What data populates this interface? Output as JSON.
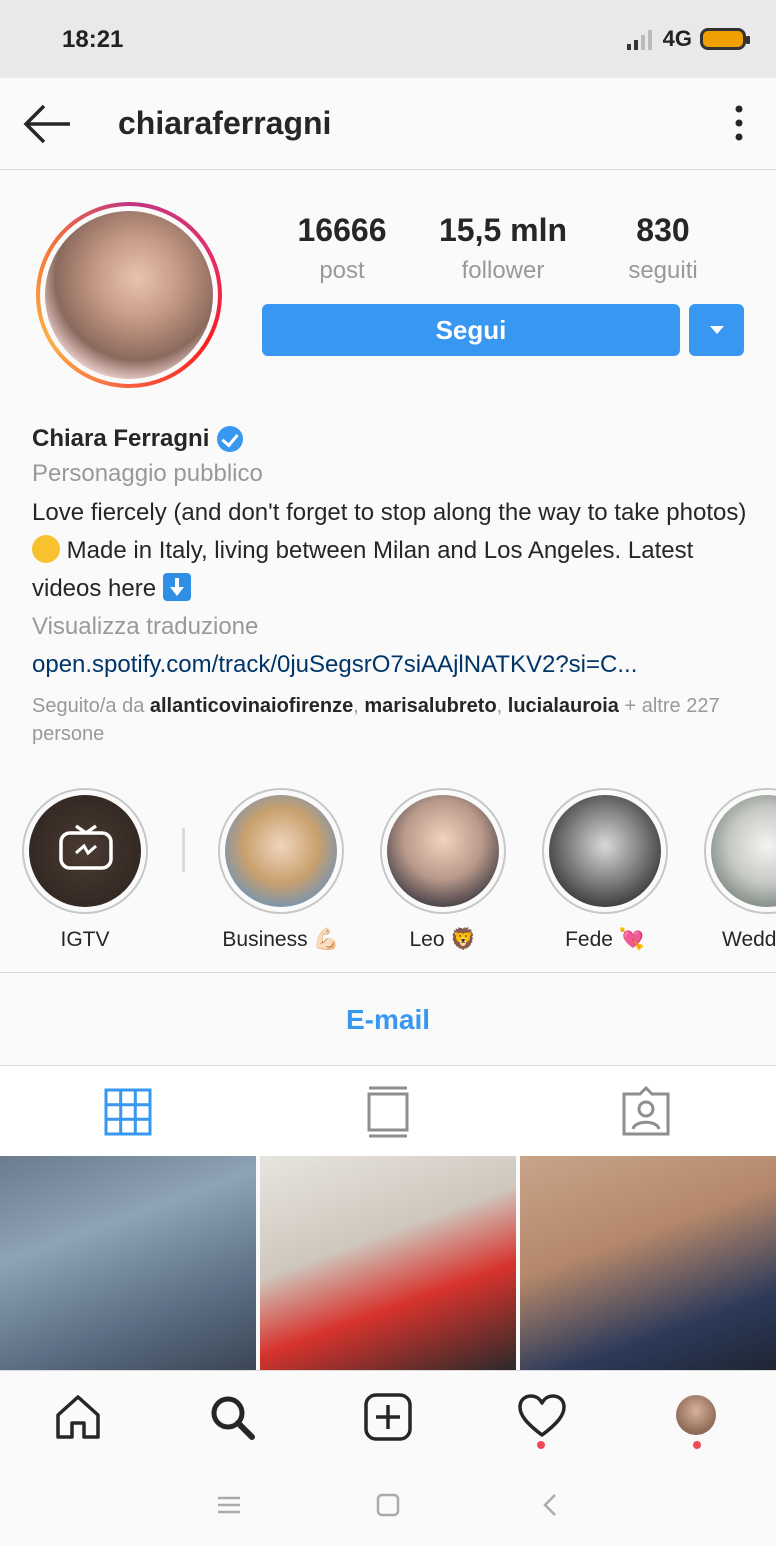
{
  "status_bar": {
    "time": "18:21",
    "network": "4G"
  },
  "header": {
    "username": "chiaraferragni"
  },
  "stats": {
    "posts": {
      "value": "16666",
      "label": "post"
    },
    "followers": {
      "value": "15,5 mln",
      "label": "follower"
    },
    "following": {
      "value": "830",
      "label": "seguiti"
    }
  },
  "follow_button": {
    "label": "Segui"
  },
  "bio": {
    "name": "Chiara Ferragni",
    "category": "Personaggio pubblico",
    "text_part1": "Love fiercely (and don't forget to stop along the way to take photos)",
    "text_part2": " Made in Italy, living between Milan and Los Angeles. Latest videos here ",
    "translate": "Visualizza traduzione",
    "link": "open.spotify.com/track/0juSegsrO7siAAjlNATKV2?si=C...",
    "followed_prefix": "Seguito/a da ",
    "followed_users": [
      "allanticovinaiofirenze",
      "marisalubreto",
      "lucialauroia"
    ],
    "followed_suffix": " + altre 227 persone"
  },
  "highlights": [
    {
      "label": "IGTV"
    },
    {
      "label": "Business 💪🏻"
    },
    {
      "label": "Leo 🦁"
    },
    {
      "label": "Fede 💘"
    },
    {
      "label": "Wedd"
    }
  ],
  "email_button": {
    "label": "E-mail"
  },
  "colors": {
    "accent": "#3897f0",
    "link": "#003569",
    "notification": "#ed4956"
  }
}
